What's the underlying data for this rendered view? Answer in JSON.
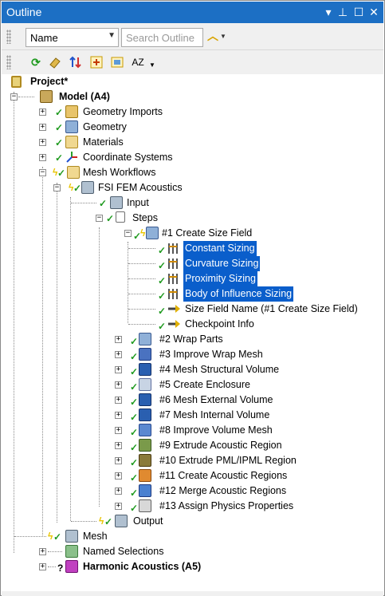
{
  "panel": {
    "title": "Outline",
    "pin_label": "▾",
    "dock_label": "⊥",
    "maximize_label": "☐",
    "close_label": "✕"
  },
  "toolbar": {
    "filter_value": "Name",
    "search_placeholder": "Search Outline",
    "sort_label": "AZ"
  },
  "tree": {
    "project": "Project*",
    "model": "Model (A4)",
    "geometry_imports": "Geometry Imports",
    "geometry": "Geometry",
    "materials": "Materials",
    "coordinate_systems": "Coordinate Systems",
    "mesh_workflows": "Mesh Workflows",
    "fsi_fem": "FSI FEM Acoustics",
    "input": "Input",
    "steps": "Steps",
    "step1": "#1 Create Size Field",
    "constant_sizing": "Constant Sizing",
    "curvature_sizing": "Curvature Sizing",
    "proximity_sizing": "Proximity Sizing",
    "body_of_influence": "Body of Influence Sizing",
    "size_field_name": "Size Field Name (#1 Create Size Field)",
    "checkpoint_info": "Checkpoint Info",
    "step2": "#2 Wrap Parts",
    "step3": "#3 Improve Wrap Mesh",
    "step4": "#4 Mesh Structural Volume",
    "step5": "#5 Create Enclosure",
    "step6": "#6 Mesh External Volume",
    "step7": "#7 Mesh Internal Volume",
    "step8": "#8 Improve Volume Mesh",
    "step9": "#9 Extrude Acoustic Region",
    "step10": "#10 Extrude PML/IPML Region",
    "step11": "#11 Create Acoustic Regions",
    "step12": "#12 Merge Acoustic Regions",
    "step13": "#13 Assign Physics Properties",
    "output": "Output",
    "mesh": "Mesh",
    "named_selections": "Named Selections",
    "harmonic": "Harmonic Acoustics (A5)"
  },
  "colors": {
    "titlebar": "#1c6fc4",
    "selection": "#0a5ecb",
    "check": "#1f9a1f",
    "lightning": "#e8c400"
  }
}
